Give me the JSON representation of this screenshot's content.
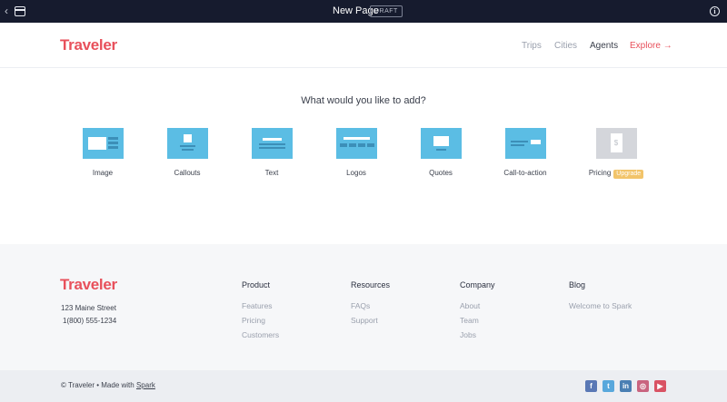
{
  "appbar": {
    "title": "New Page",
    "status": "DRAFT",
    "icons": [
      "chevron-left-icon",
      "window-icon",
      "info-icon"
    ]
  },
  "header": {
    "logo": "Traveler",
    "nav": [
      "Trips",
      "Cities",
      "Agents",
      "Explore"
    ],
    "explore_arrow": "→"
  },
  "main": {
    "question": "What would you like to add?",
    "blocks": [
      {
        "label": "Image"
      },
      {
        "label": "Callouts"
      },
      {
        "label": "Text"
      },
      {
        "label": "Logos"
      },
      {
        "label": "Quotes"
      },
      {
        "label": "Call-to-action"
      },
      {
        "label": "Pricing",
        "badge": "Upgrade",
        "thumb_symbol": "$"
      }
    ]
  },
  "footer": {
    "logo": "Traveler",
    "address": "123 Maine Street",
    "phone": "1(800) 555-1234",
    "columns": [
      {
        "title": "Product",
        "links": [
          "Features",
          "Pricing",
          "Customers"
        ]
      },
      {
        "title": "Resources",
        "links": [
          "FAQs",
          "Support"
        ]
      },
      {
        "title": "Company",
        "links": [
          "About",
          "Team",
          "Jobs"
        ]
      },
      {
        "title": "Blog",
        "links": [
          "Welcome to Spark"
        ]
      }
    ],
    "copyright_prefix": "© Traveler • Made with",
    "copyright_link": "Spark",
    "social": [
      {
        "name": "facebook-icon",
        "glyph": "f"
      },
      {
        "name": "twitter-icon",
        "glyph": "t"
      },
      {
        "name": "linkedin-icon",
        "glyph": "in"
      },
      {
        "name": "instagram-icon",
        "glyph": "◎"
      },
      {
        "name": "youtube-icon",
        "glyph": "▶"
      }
    ]
  },
  "colors": {
    "accent": "#e8505b",
    "appbar_bg": "#161b2e",
    "thumb_blue": "#5bbde4",
    "upgrade_badge": "#f2c46a",
    "footer_bg": "#f6f7f9"
  }
}
